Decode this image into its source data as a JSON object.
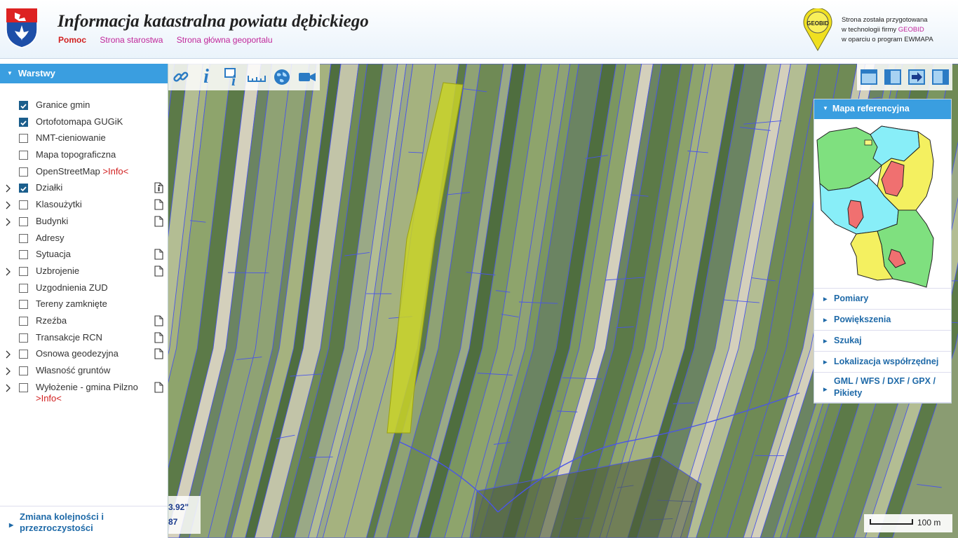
{
  "header": {
    "title": "Informacja katastralna powiatu dębickiego",
    "nav": [
      {
        "label": "Pomoc"
      },
      {
        "label": "Strona starostwa"
      },
      {
        "label": "Strona główna geoportalu"
      }
    ],
    "geobid": {
      "logo_text": "GEOBID",
      "line1": "Strona została przygotowana",
      "line2_prefix": "w technologii firmy ",
      "line2_brand": "GEOBID",
      "line3": "w oparciu o program EWMAPA"
    }
  },
  "layers_panel": {
    "title": "Warstwy",
    "items": [
      {
        "label": "Granice gmin",
        "checked": true,
        "expandable": false,
        "doc": false
      },
      {
        "label": "Ortofotomapa GUGiK",
        "checked": true,
        "expandable": false,
        "doc": false
      },
      {
        "label": "NMT-cieniowanie",
        "checked": false,
        "expandable": false,
        "doc": false
      },
      {
        "label": "Mapa topograficzna",
        "checked": false,
        "expandable": false,
        "doc": false
      },
      {
        "label": "OpenStreetMap ",
        "info": ">Info<",
        "checked": false,
        "expandable": false,
        "doc": false
      },
      {
        "label": "Działki",
        "checked": true,
        "expandable": true,
        "doc": "info"
      },
      {
        "label": "Klasoużytki",
        "checked": false,
        "expandable": true,
        "doc": true
      },
      {
        "label": "Budynki",
        "checked": false,
        "expandable": true,
        "doc": true
      },
      {
        "label": "Adresy",
        "checked": false,
        "expandable": false,
        "doc": false
      },
      {
        "label": "Sytuacja",
        "checked": false,
        "expandable": false,
        "doc": true
      },
      {
        "label": "Uzbrojenie",
        "checked": false,
        "expandable": true,
        "doc": true
      },
      {
        "label": "Uzgodnienia ZUD",
        "checked": false,
        "expandable": false,
        "doc": false
      },
      {
        "label": "Tereny zamknięte",
        "checked": false,
        "expandable": false,
        "doc": false
      },
      {
        "label": "Rzeźba",
        "checked": false,
        "expandable": false,
        "doc": true
      },
      {
        "label": "Transakcje RCN",
        "checked": false,
        "expandable": false,
        "doc": true
      },
      {
        "label": "Osnowa geodezyjna",
        "checked": false,
        "expandable": true,
        "doc": true
      },
      {
        "label": "Własność gruntów",
        "checked": false,
        "expandable": true,
        "doc": false
      },
      {
        "label": "Wyłożenie - gmina Pilzno",
        "info": ">Info<",
        "checked": false,
        "expandable": true,
        "doc": true
      }
    ],
    "footer_link": "Zmiana kolejności i przezroczystości"
  },
  "map": {
    "toolbar": [
      {
        "icon": "link-icon"
      },
      {
        "icon": "info-icon"
      },
      {
        "icon": "info-document-icon"
      },
      {
        "icon": "ruler-icon"
      },
      {
        "icon": "globe-icon"
      },
      {
        "icon": "camera-icon"
      }
    ],
    "view_tools": [
      {
        "icon": "window-icon"
      },
      {
        "icon": "panel-left-icon"
      },
      {
        "icon": "exit-icon"
      },
      {
        "icon": "panel-right-icon"
      }
    ],
    "coords": {
      "line1": "3.92\"",
      "line2": "87"
    },
    "scale_label": "100 m"
  },
  "right_panel": {
    "title": "Mapa referencyjna",
    "items": [
      {
        "label": "Pomiary"
      },
      {
        "label": "Powiększenia"
      },
      {
        "label": "Szukaj"
      },
      {
        "label": "Lokalizacja współrzędnej"
      },
      {
        "label": "GML / WFS / DXF / GPX / Pikiety"
      }
    ]
  },
  "colors": {
    "accent": "#3a9ee0",
    "link": "#1f6aa8",
    "brand": "#c0269a",
    "info_red": "#d12020",
    "parcel_lines": "#4a55e8",
    "highlight_parcel": "#c8d228"
  }
}
